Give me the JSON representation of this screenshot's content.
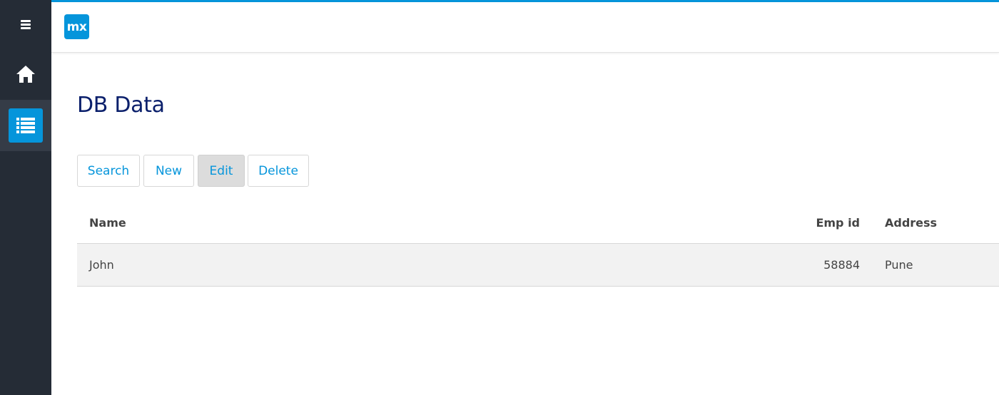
{
  "sidebar": {
    "items": [
      {
        "name": "menu-toggle",
        "icon": "hamburger-icon"
      },
      {
        "name": "home",
        "icon": "home-icon"
      },
      {
        "name": "list",
        "icon": "list-icon",
        "active": true
      }
    ]
  },
  "header": {
    "logo_text": "mx"
  },
  "page": {
    "title": "DB Data"
  },
  "toolbar": {
    "search_label": "Search",
    "new_label": "New",
    "edit_label": "Edit",
    "delete_label": "Delete"
  },
  "grid": {
    "columns": [
      "Name",
      "Emp id",
      "Address"
    ],
    "rows": [
      {
        "name": "John",
        "emp_id": "58884",
        "address": "Pune"
      }
    ]
  },
  "colors": {
    "accent": "#0595db",
    "sidebar_bg": "#252c36",
    "title": "#0a1f6b"
  }
}
